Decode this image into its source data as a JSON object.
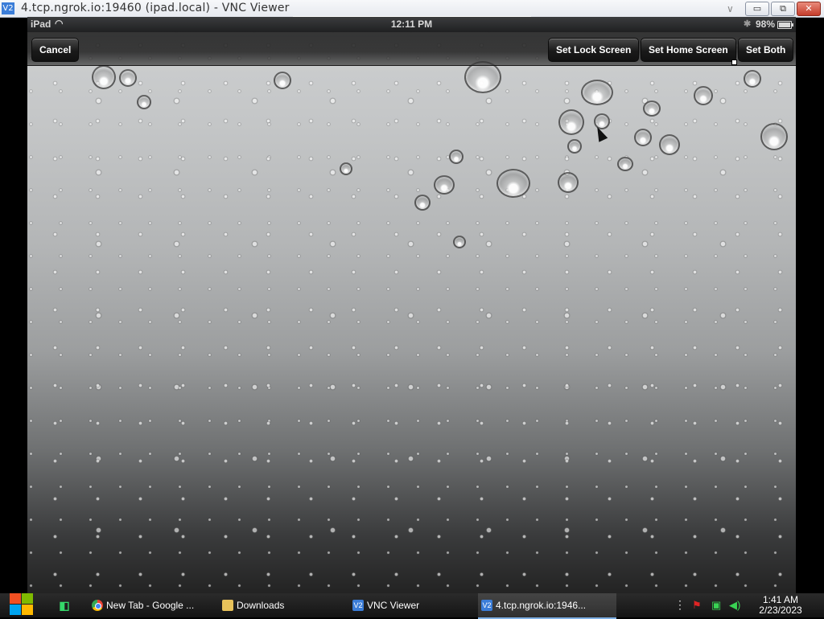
{
  "window": {
    "title": "4.tcp.ngrok.io:19460 (ipad.local) - VNC Viewer",
    "app_icon": "V2",
    "minimize": "▭",
    "restore": "⧉",
    "close": "✕"
  },
  "ipad": {
    "status": {
      "device": "iPad",
      "time": "12:11 PM",
      "battery": "98%",
      "battery_level": 0.98
    },
    "toolbar": {
      "cancel": "Cancel",
      "set_lock": "Set Lock Screen",
      "set_home": "Set Home Screen",
      "set_both": "Set Both"
    }
  },
  "taskbar": {
    "tasks": [
      {
        "label": "New Tab - Google ...",
        "icon": "chrome-icon"
      },
      {
        "label": "Downloads",
        "icon": "folder-icon"
      },
      {
        "label": "VNC Viewer",
        "icon": "vnc-icon",
        "icon_text": "V2"
      },
      {
        "label": "4.tcp.ngrok.io:1946...",
        "icon": "vnc-icon",
        "icon_text": "V2"
      }
    ],
    "clock": {
      "time": "1:41 AM",
      "date": "2/23/2023"
    }
  },
  "colors": {
    "windows_start": [
      "#f25022",
      "#7fba00",
      "#00a4ef",
      "#ffb900"
    ],
    "vnc_blue": "#3b7dd8",
    "tray_flag": "#e02424",
    "tray_network": "#39d353"
  }
}
